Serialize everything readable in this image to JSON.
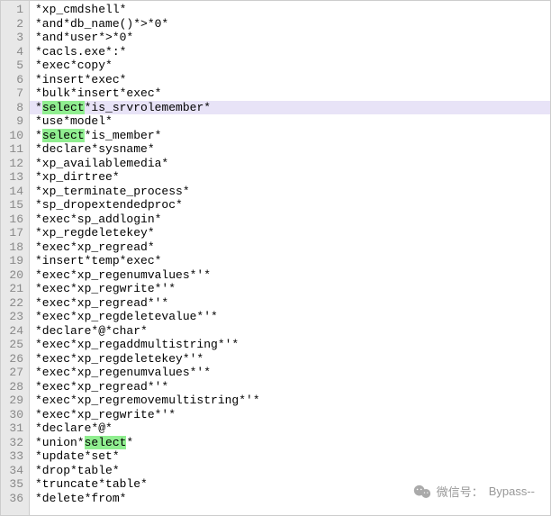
{
  "current_line": 8,
  "highlight_word": "select",
  "lines": [
    {
      "num": 1,
      "text": "*xp_cmdshell*"
    },
    {
      "num": 2,
      "text": "*and*db_name()*>*0*"
    },
    {
      "num": 3,
      "text": "*and*user*>*0*"
    },
    {
      "num": 4,
      "text": "*cacls.exe*:*"
    },
    {
      "num": 5,
      "text": "*exec*copy*"
    },
    {
      "num": 6,
      "text": "*insert*exec*"
    },
    {
      "num": 7,
      "text": "*bulk*insert*exec*"
    },
    {
      "num": 8,
      "text": "*select*is_srvrolemember*"
    },
    {
      "num": 9,
      "text": "*use*model*"
    },
    {
      "num": 10,
      "text": "*select*is_member*"
    },
    {
      "num": 11,
      "text": "*declare*sysname*"
    },
    {
      "num": 12,
      "text": "*xp_availablemedia*"
    },
    {
      "num": 13,
      "text": "*xp_dirtree*"
    },
    {
      "num": 14,
      "text": "*xp_terminate_process*"
    },
    {
      "num": 15,
      "text": "*sp_dropextendedproc*"
    },
    {
      "num": 16,
      "text": "*exec*sp_addlogin*"
    },
    {
      "num": 17,
      "text": "*xp_regdeletekey*"
    },
    {
      "num": 18,
      "text": "*exec*xp_regread*"
    },
    {
      "num": 19,
      "text": "*insert*temp*exec*"
    },
    {
      "num": 20,
      "text": "*exec*xp_regenumvalues*'*"
    },
    {
      "num": 21,
      "text": "*exec*xp_regwrite*'*"
    },
    {
      "num": 22,
      "text": "*exec*xp_regread*'*"
    },
    {
      "num": 23,
      "text": "*exec*xp_regdeletevalue*'*"
    },
    {
      "num": 24,
      "text": "*declare*@*char*"
    },
    {
      "num": 25,
      "text": "*exec*xp_regaddmultistring*'*"
    },
    {
      "num": 26,
      "text": "*exec*xp_regdeletekey*'*"
    },
    {
      "num": 27,
      "text": "*exec*xp_regenumvalues*'*"
    },
    {
      "num": 28,
      "text": "*exec*xp_regread*'*"
    },
    {
      "num": 29,
      "text": "*exec*xp_regremovemultistring*'*"
    },
    {
      "num": 30,
      "text": "*exec*xp_regwrite*'*"
    },
    {
      "num": 31,
      "text": "*declare*@*"
    },
    {
      "num": 32,
      "text": "*union*select*"
    },
    {
      "num": 33,
      "text": "*update*set*"
    },
    {
      "num": 34,
      "text": "*drop*table*"
    },
    {
      "num": 35,
      "text": "*truncate*table*"
    },
    {
      "num": 36,
      "text": "*delete*from*"
    }
  ],
  "watermark": {
    "label": "微信号：",
    "value": "Bypass--"
  }
}
